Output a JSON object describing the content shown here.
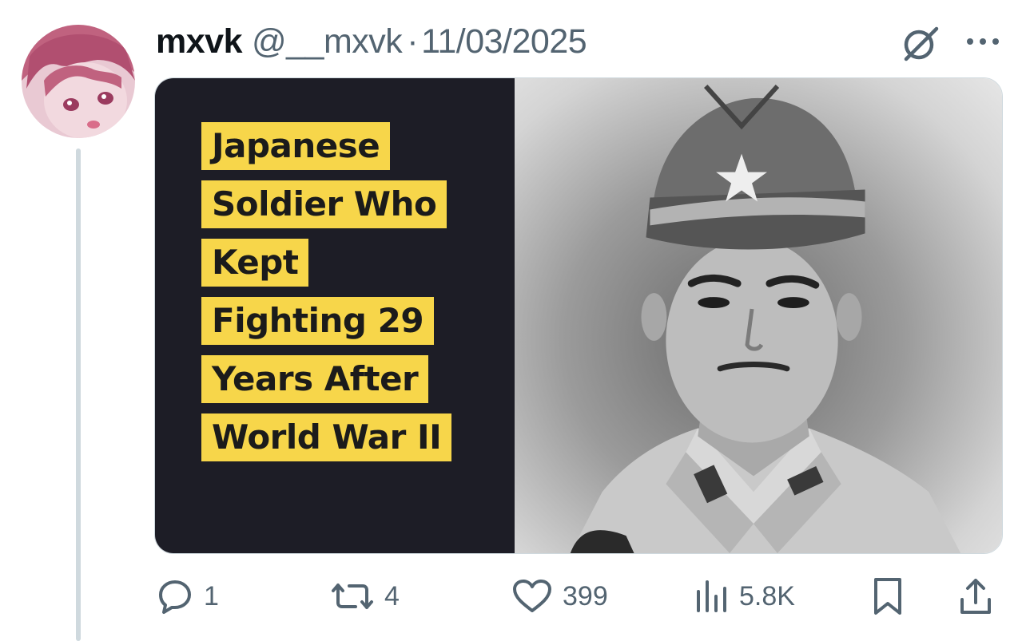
{
  "tweet": {
    "display_name": "mxvk",
    "handle": "@__mxvk",
    "separator": "·",
    "date": "11/03/2025"
  },
  "media": {
    "headline_lines": [
      "Japanese",
      "Soldier Who",
      "Kept",
      "Fighting 29",
      "Years After",
      "World War II"
    ],
    "accent_color": "#f7d64a",
    "panel_color": "#1d1d26"
  },
  "actions": {
    "reply_count": "1",
    "retweet_count": "4",
    "like_count": "399",
    "views_count": "5.8K"
  },
  "icons": {
    "grok": "grok-icon",
    "more": "more-icon",
    "reply": "reply-icon",
    "retweet": "retweet-icon",
    "like": "heart-icon",
    "views": "views-icon",
    "bookmark": "bookmark-icon",
    "share": "share-icon"
  },
  "colors": {
    "secondary_text": "#536471",
    "thread_line": "#cfd9de"
  }
}
